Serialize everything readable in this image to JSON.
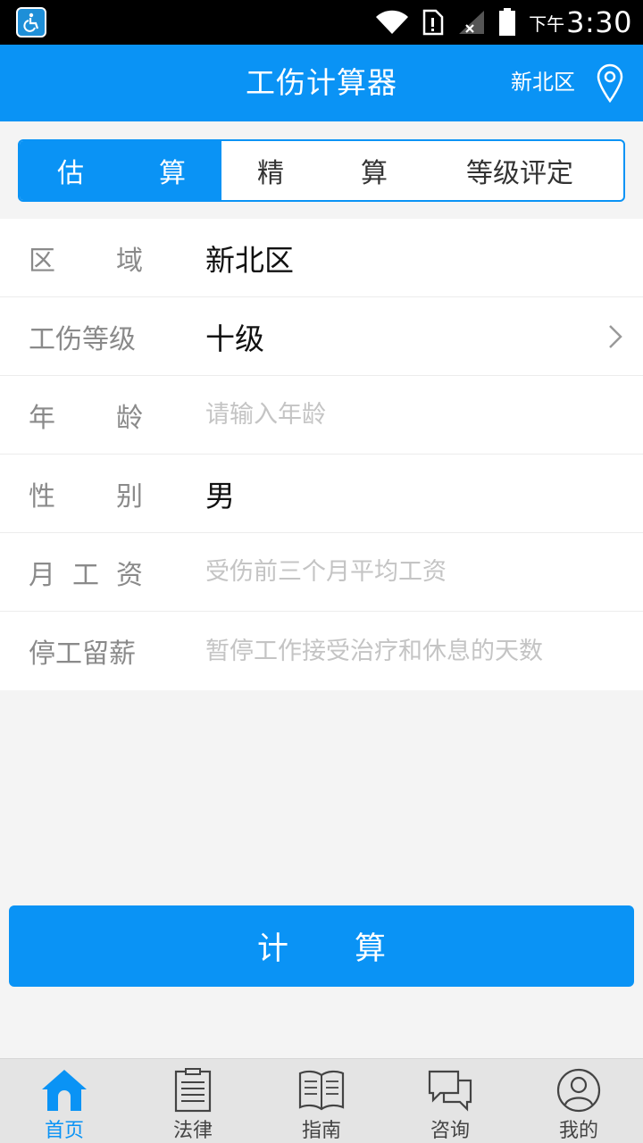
{
  "header": {
    "title": "工伤计算器",
    "location": "新北区"
  },
  "status_bar": {
    "ampm": "下午",
    "time": "3:30"
  },
  "tabs": [
    {
      "chars": [
        "估",
        "算"
      ],
      "active": true
    },
    {
      "chars": [
        "精",
        "算"
      ],
      "active": false
    },
    {
      "label": "等级评定",
      "active": false
    }
  ],
  "form": {
    "region": {
      "label_chars": [
        "区",
        "域"
      ],
      "value": "新北区"
    },
    "grade": {
      "label": "工伤等级",
      "value": "十级"
    },
    "age": {
      "label_chars": [
        "年",
        "龄"
      ],
      "placeholder": "请输入年龄"
    },
    "gender": {
      "label_chars": [
        "性",
        "别"
      ],
      "value": "男"
    },
    "salary": {
      "label_chars": [
        "月",
        "工",
        "资"
      ],
      "placeholder": "受伤前三个月平均工资"
    },
    "suspension": {
      "label": "停工留薪",
      "placeholder": "暂停工作接受治疗和休息的天数"
    }
  },
  "calc_button": {
    "chars": [
      "计",
      "算"
    ]
  },
  "bottom_nav": [
    {
      "label": "首页",
      "icon": "home-icon",
      "active": true
    },
    {
      "label": "法律",
      "icon": "law-document-icon",
      "active": false
    },
    {
      "label": "指南",
      "icon": "guide-book-icon",
      "active": false
    },
    {
      "label": "咨询",
      "icon": "consult-chat-icon",
      "active": false
    },
    {
      "label": "我的",
      "icon": "profile-icon",
      "active": false
    }
  ],
  "colors": {
    "accent": "#0a93f5",
    "label_gray": "#8a8a8a",
    "placeholder_gray": "#c4c4c4"
  }
}
